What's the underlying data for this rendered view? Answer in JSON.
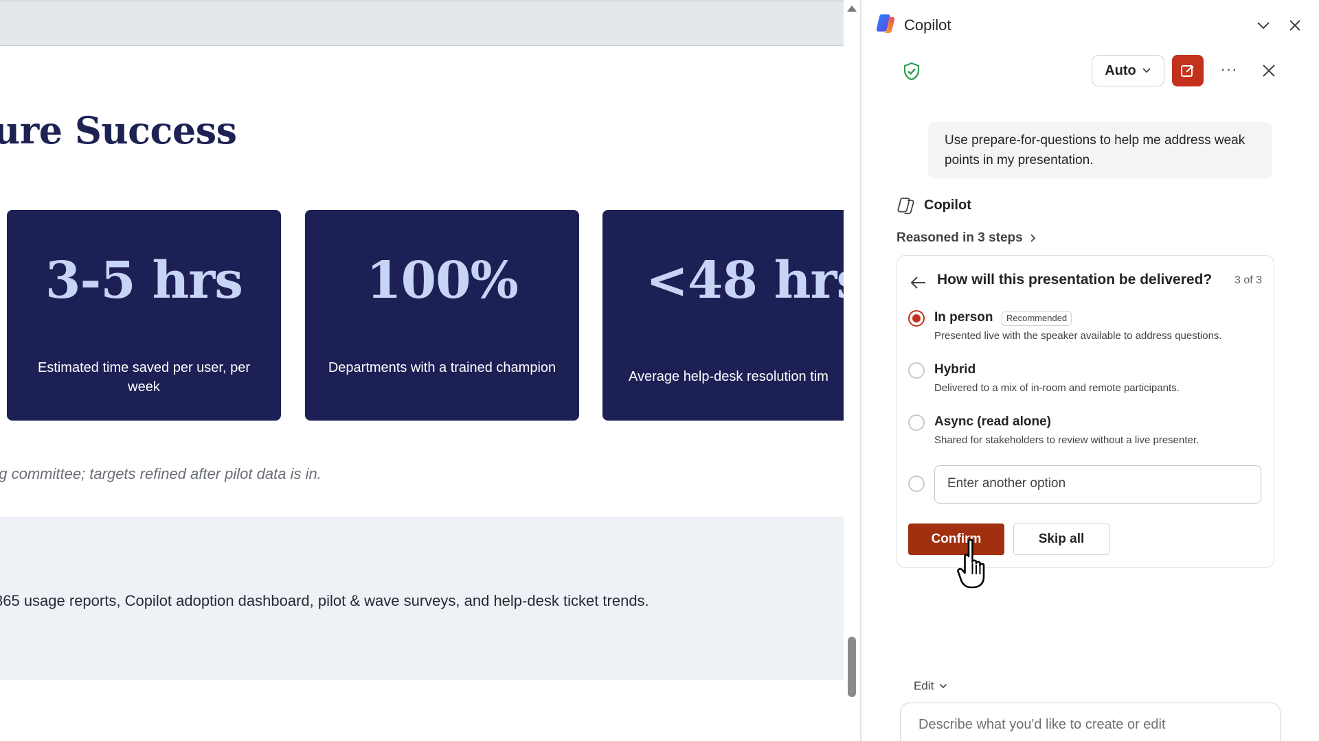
{
  "document": {
    "heading": "ure Success",
    "stats": [
      {
        "value": "3-5 hrs",
        "caption": "Estimated time saved per user, per week"
      },
      {
        "value": "100%",
        "caption": "Departments with a trained champion"
      },
      {
        "value": "<48 hrs",
        "caption": "Average help-desk resolution tim"
      }
    ],
    "note": "ng committee; targets refined after pilot data is in.",
    "sources": "365 usage reports, Copilot adoption dashboard, pilot & wave surveys, and help-desk ticket trends."
  },
  "pane": {
    "title": "Copilot",
    "mode_label": "Auto",
    "more_label": "···",
    "user_message": "Use prepare-for-questions to help me address weak points in my presentation.",
    "assistant_name": "Copilot",
    "reasoned_label": "Reasoned in 3 steps",
    "question": {
      "title": "How will this presentation be delivered?",
      "step": "3 of 3",
      "options": [
        {
          "label": "In person",
          "badge": "Recommended",
          "description": "Presented live with the speaker available to address questions.",
          "selected": true
        },
        {
          "label": "Hybrid",
          "description": "Delivered to a mix of in-room and remote participants.",
          "selected": false
        },
        {
          "label": "Async (read alone)",
          "description": "Shared for stakeholders to review without a live presenter.",
          "selected": false
        }
      ],
      "other_placeholder": "Enter another option",
      "confirm_label": "Confirm",
      "skip_label": "Skip all"
    },
    "edit_label": "Edit",
    "compose_placeholder": "Describe what you'd like to create or edit"
  },
  "colors": {
    "accent": "#c4311c",
    "confirm": "#a0300f",
    "card_bg": "#1d2055",
    "card_value": "#c8d4f6",
    "heading": "#1d2253",
    "shield": "#2e9e4f"
  },
  "icons": [
    "copilot-logo-icon",
    "chevron-down-icon",
    "close-icon",
    "shield-check-icon",
    "new-chat-icon",
    "more-icon",
    "copilot-avatar-icon",
    "chevron-right-icon",
    "arrow-left-icon",
    "hand-cursor-icon"
  ]
}
